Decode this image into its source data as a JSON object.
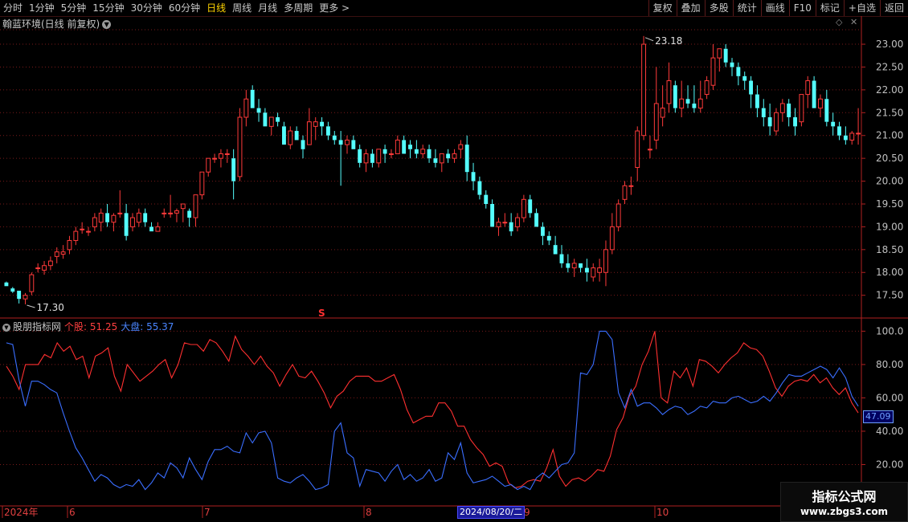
{
  "toolbar": {
    "periods": [
      "分时",
      "1分钟",
      "5分钟",
      "15分钟",
      "30分钟",
      "60分钟",
      "日线",
      "周线",
      "月线",
      "多周期",
      "更多 >"
    ],
    "active_period": "日线",
    "right_buttons": [
      "复权",
      "叠加",
      "多股",
      "统计",
      "画线",
      "F10",
      "标记",
      "+自选",
      "返回"
    ]
  },
  "main_chart": {
    "title": "翰蓝环境(日线 前复权)",
    "high_label": "23.18",
    "low_label": "17.30",
    "marker": "S",
    "price_axis": [
      "23.00",
      "22.50",
      "22.00",
      "21.50",
      "21.00",
      "20.50",
      "20.00",
      "19.50",
      "19.00",
      "18.50",
      "18.00",
      "17.50"
    ],
    "colors": {
      "up": "#ff3a3a",
      "down": "#54ffff",
      "grid": "#7a1a1a"
    }
  },
  "indicator": {
    "name": "股朋指标网",
    "series1_label": "个股: 51.25",
    "series2_label": "大盘: 55.37",
    "axis": [
      "100.0",
      "80.00",
      "60.00",
      "40.00",
      "20.00"
    ],
    "current_value": "47.09"
  },
  "time_axis": {
    "labels": [
      "2024年",
      "6",
      "7",
      "8",
      "9",
      "10"
    ],
    "highlight_date": "2024/08/20/二"
  },
  "watermark": {
    "line1": "指标公式网",
    "line2": "www.zbgs3.com"
  },
  "chart_data": {
    "type": "candlestick",
    "title": "翰蓝环境(日线 前复权)",
    "y_range": [
      17.2,
      23.3
    ],
    "y_ticks": [
      17.5,
      18.0,
      18.5,
      19.0,
      19.5,
      20.0,
      20.5,
      21.0,
      21.5,
      22.0,
      22.5,
      23.0
    ],
    "x_labels": [
      "2024年",
      "6",
      "7",
      "8",
      "9",
      "10"
    ],
    "ohlc": [
      [
        17.78,
        17.8,
        17.7,
        17.7
      ],
      [
        17.65,
        17.68,
        17.55,
        17.58
      ],
      [
        17.6,
        17.6,
        17.32,
        17.42
      ],
      [
        17.42,
        17.55,
        17.3,
        17.5
      ],
      [
        17.58,
        18.0,
        17.5,
        17.95
      ],
      [
        18.1,
        18.2,
        18.0,
        18.1
      ],
      [
        18.05,
        18.25,
        17.95,
        18.15
      ],
      [
        18.15,
        18.35,
        18.05,
        18.25
      ],
      [
        18.35,
        18.55,
        18.2,
        18.45
      ],
      [
        18.4,
        18.6,
        18.3,
        18.45
      ],
      [
        18.5,
        18.8,
        18.4,
        18.7
      ],
      [
        18.7,
        19.0,
        18.6,
        18.9
      ],
      [
        18.95,
        19.1,
        18.85,
        18.95
      ],
      [
        18.9,
        19.0,
        18.8,
        18.9
      ],
      [
        19.0,
        19.3,
        18.9,
        19.2
      ],
      [
        19.1,
        19.4,
        18.9,
        19.3
      ],
      [
        19.3,
        19.5,
        19.0,
        19.1
      ],
      [
        19.1,
        19.3,
        18.9,
        19.25
      ],
      [
        19.3,
        19.8,
        19.2,
        19.3
      ],
      [
        19.3,
        19.5,
        18.7,
        18.8
      ],
      [
        19.0,
        19.3,
        18.9,
        19.2
      ],
      [
        19.1,
        19.4,
        19.0,
        19.3
      ],
      [
        19.3,
        19.4,
        19.0,
        19.1
      ],
      [
        19.0,
        19.1,
        18.9,
        18.9
      ],
      [
        18.9,
        19.1,
        18.9,
        19.0
      ],
      [
        19.3,
        19.4,
        19.2,
        19.3
      ],
      [
        19.3,
        19.7,
        19.2,
        19.3
      ],
      [
        19.3,
        19.4,
        19.1,
        19.35
      ],
      [
        19.4,
        19.5,
        19.1,
        19.5
      ],
      [
        19.35,
        19.4,
        19.0,
        19.2
      ],
      [
        19.2,
        19.5,
        19.0,
        19.7
      ],
      [
        19.7,
        20.2,
        19.6,
        20.2
      ],
      [
        20.2,
        20.5,
        20.1,
        20.5
      ],
      [
        20.5,
        20.6,
        20.4,
        20.5
      ],
      [
        20.5,
        20.7,
        20.3,
        20.6
      ],
      [
        20.6,
        20.7,
        20.4,
        20.6
      ],
      [
        20.5,
        20.7,
        19.6,
        20.0
      ],
      [
        20.1,
        21.6,
        20.0,
        21.4
      ],
      [
        21.4,
        22.0,
        21.2,
        21.8
      ],
      [
        22.0,
        22.1,
        21.6,
        21.6
      ],
      [
        21.6,
        21.8,
        21.3,
        21.5
      ],
      [
        21.5,
        21.6,
        21.2,
        21.2
      ],
      [
        21.2,
        21.4,
        21.0,
        21.4
      ],
      [
        21.4,
        21.5,
        21.2,
        21.3
      ],
      [
        21.2,
        21.3,
        20.8,
        20.8
      ],
      [
        20.8,
        21.2,
        20.7,
        21.1
      ],
      [
        21.1,
        21.2,
        20.9,
        20.9
      ],
      [
        20.9,
        21.0,
        20.5,
        20.7
      ],
      [
        20.8,
        21.6,
        20.8,
        21.3
      ],
      [
        21.2,
        21.4,
        20.9,
        21.3
      ],
      [
        21.3,
        21.4,
        21.0,
        21.2
      ],
      [
        21.2,
        21.3,
        20.9,
        21.0
      ],
      [
        21.0,
        21.1,
        20.8,
        20.9
      ],
      [
        20.9,
        21.1,
        19.9,
        20.8
      ],
      [
        20.8,
        21.0,
        20.6,
        20.9
      ],
      [
        20.9,
        21.0,
        20.7,
        20.7
      ],
      [
        20.7,
        20.8,
        20.3,
        20.4
      ],
      [
        20.4,
        20.7,
        20.2,
        20.6
      ],
      [
        20.6,
        20.7,
        20.3,
        20.4
      ],
      [
        20.4,
        20.7,
        20.3,
        20.7
      ],
      [
        20.7,
        20.8,
        20.4,
        20.6
      ],
      [
        20.6,
        20.7,
        20.5,
        20.6
      ],
      [
        20.6,
        21.0,
        20.6,
        20.9
      ],
      [
        20.9,
        21.0,
        20.6,
        20.6
      ],
      [
        20.8,
        20.9,
        20.5,
        20.7
      ],
      [
        20.7,
        20.9,
        20.5,
        20.6
      ],
      [
        20.6,
        20.8,
        20.5,
        20.7
      ],
      [
        20.7,
        20.8,
        20.4,
        20.5
      ],
      [
        20.5,
        20.7,
        20.3,
        20.4
      ],
      [
        20.4,
        20.6,
        20.2,
        20.6
      ],
      [
        20.6,
        20.7,
        20.4,
        20.5
      ],
      [
        20.5,
        20.7,
        20.4,
        20.6
      ],
      [
        20.7,
        20.9,
        20.5,
        20.8
      ],
      [
        20.8,
        21.0,
        20.0,
        20.2
      ],
      [
        20.2,
        20.4,
        19.8,
        20.0
      ],
      [
        20.0,
        20.1,
        19.6,
        19.7
      ],
      [
        19.7,
        19.8,
        19.4,
        19.5
      ],
      [
        19.5,
        19.6,
        19.0,
        19.0
      ],
      [
        19.0,
        19.2,
        18.8,
        19.1
      ],
      [
        19.1,
        19.3,
        19.0,
        19.1
      ],
      [
        19.1,
        19.3,
        18.8,
        18.9
      ],
      [
        19.0,
        19.3,
        18.9,
        19.2
      ],
      [
        19.2,
        19.7,
        19.1,
        19.6
      ],
      [
        19.6,
        19.7,
        19.2,
        19.3
      ],
      [
        19.3,
        19.4,
        19.0,
        19.0
      ],
      [
        19.0,
        19.1,
        18.6,
        18.8
      ],
      [
        18.8,
        18.9,
        18.6,
        18.7
      ],
      [
        18.6,
        18.8,
        18.4,
        18.4
      ],
      [
        18.4,
        18.6,
        18.1,
        18.2
      ],
      [
        18.2,
        18.4,
        18.0,
        18.1
      ],
      [
        18.1,
        18.3,
        17.9,
        18.2
      ],
      [
        18.2,
        18.2,
        18.0,
        18.1
      ],
      [
        18.1,
        18.3,
        17.8,
        18.0
      ],
      [
        17.9,
        18.2,
        17.8,
        18.1
      ],
      [
        18.0,
        18.3,
        17.8,
        18.1
      ],
      [
        18.0,
        18.7,
        17.7,
        18.5
      ],
      [
        18.5,
        19.3,
        18.4,
        19.0
      ],
      [
        19.0,
        19.6,
        18.9,
        19.5
      ],
      [
        19.6,
        20.0,
        19.5,
        19.9
      ],
      [
        19.9,
        20.1,
        19.7,
        19.9
      ],
      [
        20.3,
        21.2,
        20.0,
        21.1
      ],
      [
        21.0,
        23.18,
        20.9,
        23.0
      ],
      [
        20.7,
        21.0,
        20.5,
        20.7
      ],
      [
        20.9,
        22.5,
        20.7,
        21.7
      ],
      [
        21.4,
        22.1,
        21.2,
        21.6
      ],
      [
        21.7,
        22.6,
        21.5,
        22.2
      ],
      [
        22.1,
        22.2,
        21.5,
        21.6
      ],
      [
        21.6,
        22.2,
        21.4,
        21.8
      ],
      [
        21.8,
        22.1,
        21.6,
        21.7
      ],
      [
        21.7,
        22.1,
        21.5,
        21.6
      ],
      [
        21.6,
        22.2,
        21.5,
        21.8
      ],
      [
        21.9,
        22.3,
        21.8,
        22.2
      ],
      [
        22.1,
        23.0,
        22.0,
        22.7
      ],
      [
        22.7,
        22.9,
        22.4,
        22.9
      ],
      [
        22.9,
        23.0,
        22.5,
        22.6
      ],
      [
        22.6,
        22.7,
        22.3,
        22.5
      ],
      [
        22.5,
        22.6,
        22.1,
        22.3
      ],
      [
        22.3,
        22.4,
        22.0,
        22.2
      ],
      [
        22.2,
        22.3,
        21.6,
        21.9
      ],
      [
        21.9,
        22.1,
        21.4,
        21.6
      ],
      [
        21.6,
        21.8,
        21.2,
        21.4
      ],
      [
        21.4,
        21.7,
        21.0,
        21.2
      ],
      [
        21.1,
        21.6,
        21.0,
        21.5
      ],
      [
        21.5,
        21.8,
        21.3,
        21.7
      ],
      [
        21.7,
        21.8,
        21.2,
        21.4
      ],
      [
        21.4,
        21.6,
        21.0,
        21.2
      ],
      [
        21.3,
        21.9,
        21.2,
        21.9
      ],
      [
        21.9,
        22.3,
        21.6,
        22.2
      ],
      [
        22.2,
        22.3,
        21.6,
        21.6
      ],
      [
        21.6,
        21.9,
        21.4,
        21.8
      ],
      [
        21.8,
        22.0,
        21.2,
        21.3
      ],
      [
        21.3,
        21.5,
        21.0,
        21.2
      ],
      [
        21.2,
        21.3,
        20.9,
        21.0
      ],
      [
        21.0,
        21.2,
        20.8,
        20.9
      ],
      [
        20.9,
        21.1,
        20.8,
        21.05
      ],
      [
        21.05,
        21.6,
        20.8,
        21.05
      ]
    ],
    "indicator_series": [
      {
        "name": "个股",
        "values": [
          79,
          73,
          65,
          80,
          80,
          80,
          86,
          84,
          93,
          88,
          91,
          83,
          85,
          72,
          85,
          87,
          90,
          73,
          64,
          80,
          75,
          70,
          73,
          76,
          80,
          83,
          72,
          80,
          93,
          92,
          92,
          88,
          95,
          93,
          88,
          82,
          97,
          89,
          85,
          80,
          85,
          79,
          75,
          67,
          74,
          80,
          73,
          72,
          76,
          70,
          63,
          54,
          61,
          64,
          70,
          73,
          73,
          73,
          70,
          70,
          72,
          74,
          65,
          53,
          45,
          47,
          49,
          49,
          57,
          57,
          52,
          43,
          43,
          35,
          30,
          26,
          19,
          21,
          19,
          9,
          6,
          7,
          10,
          11,
          10,
          18,
          29,
          13,
          7,
          11,
          12,
          10,
          13,
          17,
          16,
          25,
          41,
          48,
          61,
          67,
          80,
          88,
          100,
          60,
          57,
          76,
          72,
          78,
          67,
          83,
          82,
          79,
          75,
          80,
          84,
          87,
          93,
          90,
          89,
          85,
          76,
          66,
          61,
          67,
          70,
          71,
          70,
          74,
          69,
          72,
          66,
          62,
          66,
          57,
          51
        ]
      },
      {
        "name": "大盘",
        "values": [
          93,
          92,
          71,
          55,
          70,
          70,
          68,
          65,
          63,
          51,
          40,
          30,
          24,
          17,
          10,
          14,
          12,
          8,
          6,
          8,
          7,
          11,
          5,
          9,
          15,
          12,
          21,
          18,
          12,
          24,
          17,
          11,
          22,
          29,
          29,
          31,
          28,
          27,
          39,
          33,
          39,
          40,
          33,
          12,
          10,
          9,
          12,
          14,
          10,
          5,
          6,
          8,
          40,
          45,
          27,
          24,
          7,
          17,
          16,
          15,
          10,
          16,
          20,
          11,
          14,
          10,
          12,
          17,
          10,
          12,
          27,
          23,
          33,
          15,
          9,
          10,
          11,
          13,
          10,
          7,
          8,
          5,
          7,
          5,
          12,
          15,
          12,
          16,
          20,
          21,
          27,
          75,
          74,
          80,
          100,
          100,
          95,
          63,
          54,
          65,
          55,
          57,
          57,
          54,
          50,
          53,
          55,
          54,
          50,
          52,
          55,
          54,
          58,
          57,
          57,
          60,
          61,
          59,
          57,
          58,
          61,
          58,
          63,
          69,
          74,
          73,
          73,
          75,
          77,
          79,
          77,
          72,
          78,
          72,
          61,
          55
        ]
      }
    ],
    "indicator_range": [
      0,
      105
    ]
  }
}
